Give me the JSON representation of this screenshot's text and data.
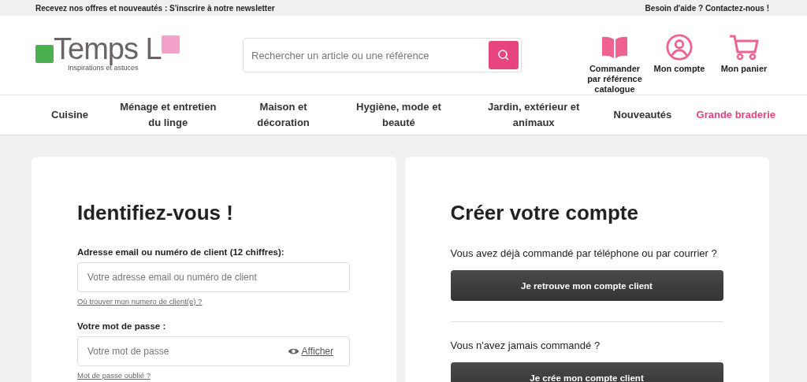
{
  "top_bar": {
    "left": "Recevez nos offres et nouveautés : S'inscrire à notre newsletter",
    "right": "Besoin d'aide ? Contactez-nous !"
  },
  "logo": {
    "name": "Temps L",
    "tagline": "Inspirations et astuces"
  },
  "search": {
    "placeholder": "Rechercher un article ou une référence"
  },
  "header_actions": [
    {
      "kind": "book",
      "label": "Commander par référence catalogue"
    },
    {
      "kind": "account",
      "label": "Mon compte"
    },
    {
      "kind": "cart",
      "label": "Mon panier"
    }
  ],
  "nav": [
    {
      "label": "Cuisine",
      "highlighted": false
    },
    {
      "label": "Ménage et entretien du linge",
      "highlighted": false
    },
    {
      "label": "Maison et décoration",
      "highlighted": false
    },
    {
      "label": "Hygiène, mode et beauté",
      "highlighted": false
    },
    {
      "label": "Jardin, extérieur et animaux",
      "highlighted": false
    },
    {
      "label": "Nouveautés",
      "highlighted": false
    },
    {
      "label": "Grande braderie",
      "highlighted": true
    }
  ],
  "login": {
    "title": "Identifiez-vous !",
    "email_label": "Adresse email ou numéro de client (12 chiffres):",
    "email_placeholder": "Votre adresse email ou numéro de client",
    "client_number_link": "Où trouver mon numero de client(e) ?",
    "password_label": "Votre mot de passe :",
    "password_placeholder": "Votre mot de passe",
    "show_password": "Afficher",
    "forgot_link": "Mot de passe oublié ?"
  },
  "register": {
    "title": "Créer votre compte",
    "question_1": "Vous avez déjà commandé par téléphone ou par courrier ?",
    "button_1": "Je retrouve mon compte client",
    "question_2": "Vous n'avez jamais commandé ?",
    "button_2": "Je crée mon compte client"
  }
}
